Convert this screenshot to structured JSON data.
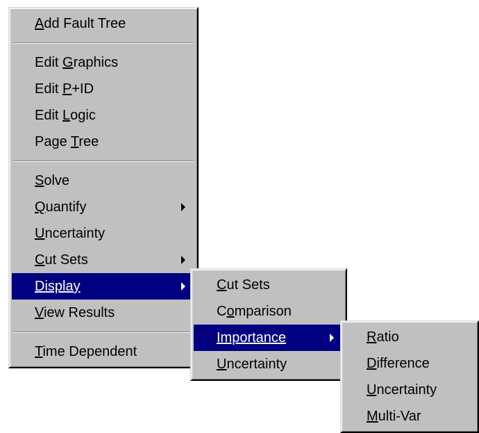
{
  "main_menu": {
    "items": [
      {
        "pre": "",
        "u": "A",
        "post": "dd Fault Tree"
      },
      {
        "pre": "Edit ",
        "u": "G",
        "post": "raphics"
      },
      {
        "pre": "Edit ",
        "u": "P",
        "post": "+ID"
      },
      {
        "pre": "Edit ",
        "u": "L",
        "post": "ogic"
      },
      {
        "pre": "Page ",
        "u": "T",
        "post": "ree"
      },
      {
        "pre": "",
        "u": "S",
        "post": "olve"
      },
      {
        "pre": "",
        "u": "Q",
        "post": "uantify"
      },
      {
        "pre": "",
        "u": "U",
        "post": "ncertainty"
      },
      {
        "pre": "",
        "u": "C",
        "post": "ut Sets"
      },
      {
        "pre": "",
        "u": "Display",
        "post": ""
      },
      {
        "pre": "",
        "u": "V",
        "post": "iew Results"
      },
      {
        "pre": "",
        "u": "T",
        "post": "ime Dependent"
      }
    ]
  },
  "display_menu": {
    "items": [
      {
        "pre": "",
        "u": "C",
        "post": "ut Sets"
      },
      {
        "pre": "C",
        "u": "o",
        "post": "mparison"
      },
      {
        "pre": "",
        "u": "Importance",
        "post": ""
      },
      {
        "pre": "",
        "u": "U",
        "post": "ncertainty"
      }
    ]
  },
  "importance_menu": {
    "items": [
      {
        "pre": "",
        "u": "R",
        "post": "atio"
      },
      {
        "pre": "",
        "u": "D",
        "post": "ifference"
      },
      {
        "pre": "",
        "u": "U",
        "post": "ncertainty"
      },
      {
        "pre": "",
        "u": "M",
        "post": "ulti-Var"
      }
    ]
  },
  "colors": {
    "menu_bg": "#c0c0c0",
    "highlight_bg": "#000080",
    "highlight_text": "#ffffff"
  },
  "icons": {
    "submenu_arrow": "submenu-arrow-icon"
  }
}
